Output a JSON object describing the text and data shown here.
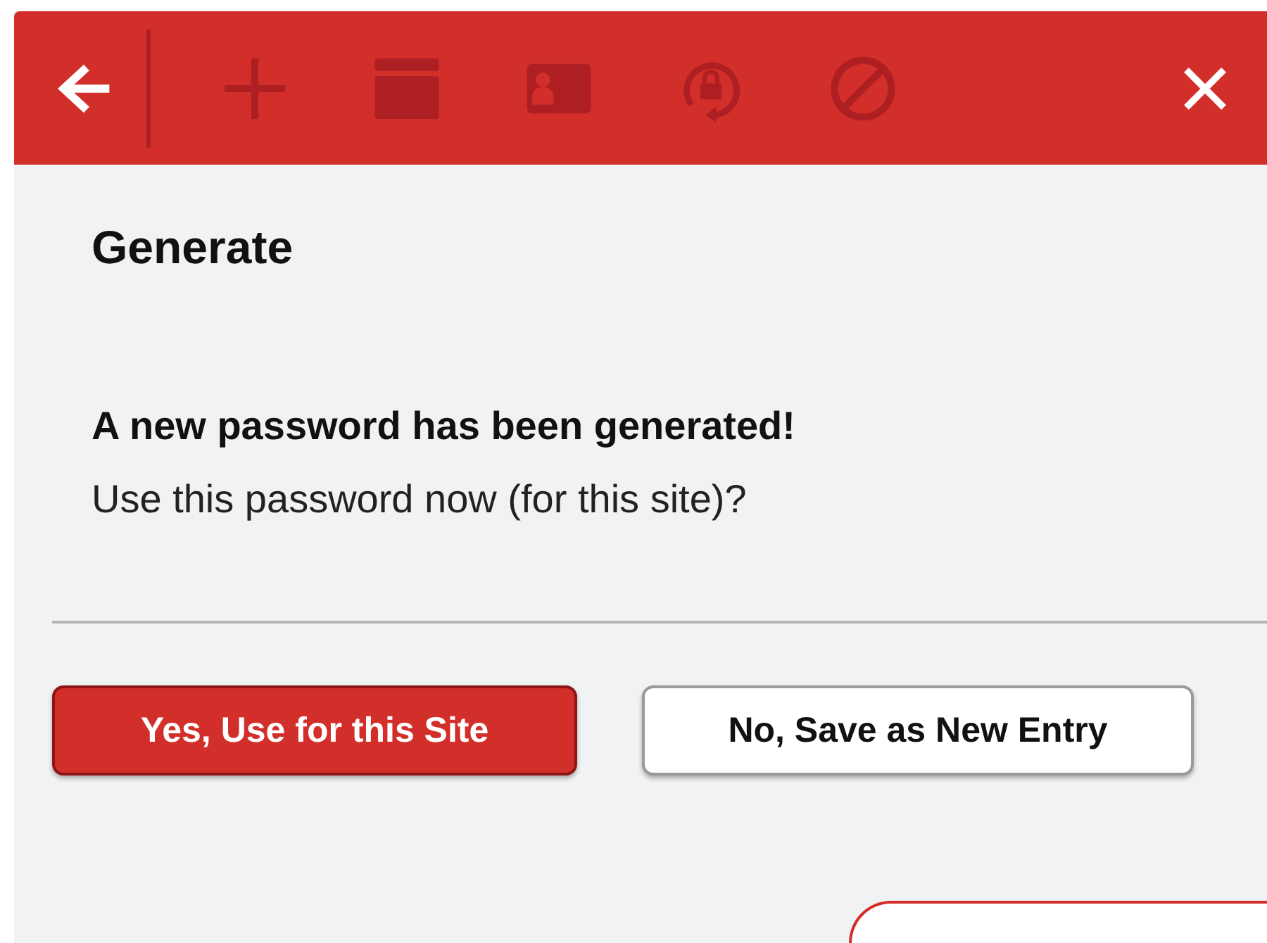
{
  "toolbar": {
    "items": [
      {
        "kind": "back",
        "disabled": false
      },
      {
        "kind": "add",
        "disabled": true
      },
      {
        "kind": "window",
        "disabled": true
      },
      {
        "kind": "identity",
        "disabled": true
      },
      {
        "kind": "lock-refresh",
        "disabled": true
      },
      {
        "kind": "block",
        "disabled": true
      }
    ],
    "close": {
      "kind": "close",
      "disabled": false
    }
  },
  "heading": "Generate",
  "message": {
    "title": "A new password has been generated!",
    "text": "Use this password now (for this site)?"
  },
  "buttons": [
    {
      "label": "Yes, Use for this Site",
      "kind": "primary"
    },
    {
      "label": "No, Save as New Entry",
      "kind": "secondary"
    }
  ]
}
